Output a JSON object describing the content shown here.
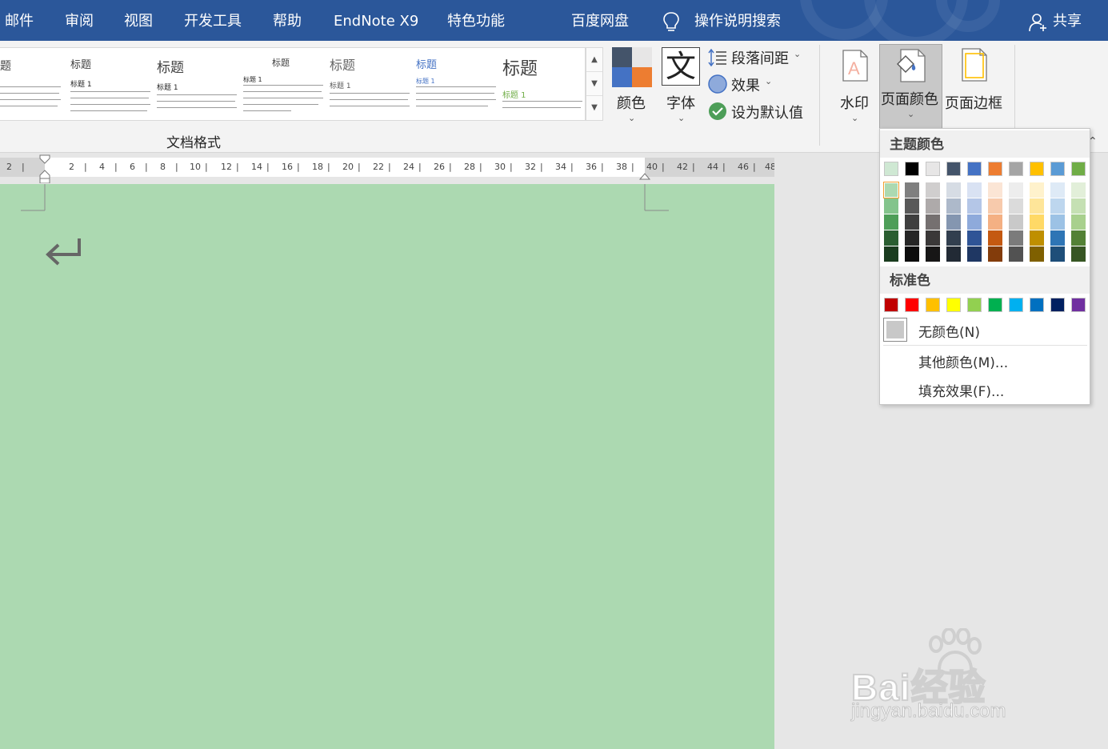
{
  "menu": {
    "tabs": [
      "邮件",
      "审阅",
      "视图",
      "开发工具",
      "帮助",
      "EndNote X9",
      "特色功能",
      "百度网盘"
    ],
    "tell_me": "操作说明搜索",
    "share": "共享"
  },
  "ribbon": {
    "gallery_label": "文档格式",
    "style_title": "标题",
    "style_heading1": "标题 1",
    "colors_label": "颜色",
    "fonts_label": "字体",
    "fonts_glyph": "文",
    "paragraph_spacing": "段落间距",
    "effects": "效果",
    "set_default": "设为默认值",
    "watermark": "水印",
    "page_color": "页面颜色",
    "page_borders": "页面边框"
  },
  "ruler": {
    "ticks": [
      "2",
      "2",
      "4",
      "6",
      "8",
      "10",
      "12",
      "14",
      "16",
      "18",
      "20",
      "22",
      "24",
      "26",
      "28",
      "30",
      "32",
      "34",
      "36",
      "38",
      "40",
      "42",
      "44",
      "46",
      "48"
    ]
  },
  "page_color_menu": {
    "theme_header": "主题颜色",
    "standard_header": "标准色",
    "no_color": "无颜色(N)",
    "more_colors": "其他颜色(M)...",
    "fill_effects": "填充效果(F)...",
    "theme_top_row": [
      "#cfe8d3",
      "#000000",
      "#e7e6e6",
      "#44546a",
      "#4472c4",
      "#ed7d31",
      "#a5a5a5",
      "#ffc000",
      "#5b9bd5",
      "#70ad47"
    ],
    "theme_shades": [
      [
        "#acd9b1",
        "#7f7f7f",
        "#d0cece",
        "#d6dce4",
        "#d9e2f3",
        "#fbe5d5",
        "#ededed",
        "#fff2cc",
        "#deeaf6",
        "#e2efd9"
      ],
      [
        "#83c48c",
        "#595959",
        "#aeaaaa",
        "#adb9ca",
        "#b4c6e7",
        "#f7caac",
        "#dbdbdb",
        "#fee599",
        "#bdd6ee",
        "#c5e0b3"
      ],
      [
        "#4d9e58",
        "#3f3f3f",
        "#757070",
        "#8496b0",
        "#8eaadb",
        "#f4b083",
        "#c9c9c9",
        "#ffd966",
        "#9cc2e5",
        "#a8d08d"
      ],
      [
        "#2a5e31",
        "#262626",
        "#3a3838",
        "#323f4f",
        "#2f5496",
        "#c45911",
        "#7b7b7b",
        "#bf8f00",
        "#2e75b5",
        "#538135"
      ],
      [
        "#1a3c1f",
        "#0c0c0c",
        "#171616",
        "#222a35",
        "#1f3763",
        "#833c0b",
        "#525252",
        "#7f6000",
        "#1e4e79",
        "#375623"
      ]
    ],
    "standard_colors": [
      "#c00000",
      "#ff0000",
      "#ffc000",
      "#ffff00",
      "#92d050",
      "#00b050",
      "#00b0f0",
      "#0070c0",
      "#002060",
      "#7030a0"
    ]
  },
  "document": {
    "background": "#acd9b1"
  },
  "watermark": {
    "logo": "Bai经验",
    "url": "jingyan.baidu.com"
  }
}
